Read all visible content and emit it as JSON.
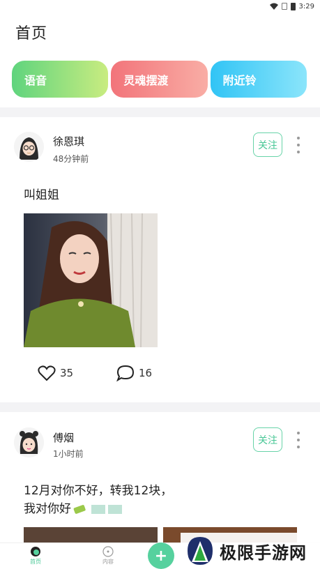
{
  "status_bar": {
    "time": "3:29",
    "icons": [
      "wifi-icon",
      "sim-icon",
      "battery-icon"
    ]
  },
  "header": {
    "title": "首页"
  },
  "tabs": [
    {
      "label": "语音"
    },
    {
      "label": "灵魂摆渡"
    },
    {
      "label": "附近铃"
    }
  ],
  "posts": [
    {
      "user": "徐恩琪",
      "time": "48分钟前",
      "follow_label": "关注",
      "text": "叫姐姐",
      "likes": "35",
      "comments": "16"
    },
    {
      "user": "傅烟",
      "time": "1小时前",
      "follow_label": "关注",
      "text_line1": "12月对你不好，转我12块，",
      "text_line2": "我对你好"
    }
  ],
  "bottom_nav": {
    "items": [
      {
        "label": "首页",
        "icon": "home-icon"
      },
      {
        "label": "内容",
        "icon": "discover-icon"
      }
    ],
    "add_label": "+"
  },
  "watermark": {
    "text": "极限手游网"
  },
  "colors": {
    "accent": "#56d19e",
    "follow": "#48c796"
  }
}
